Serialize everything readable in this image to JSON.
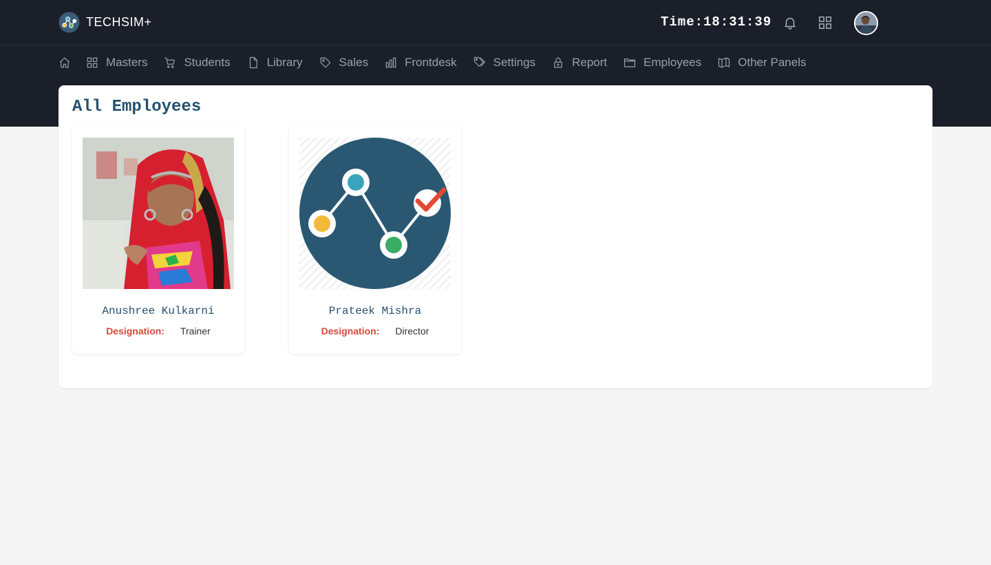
{
  "app": {
    "brand_name": "TECHSIM+",
    "clock_text": "Time:18:31:39"
  },
  "topbar": {
    "icons": [
      "bell-icon",
      "apps-grid-icon"
    ],
    "avatar": "user-avatar"
  },
  "nav": {
    "items": [
      {
        "label": "",
        "icon": "home-icon"
      },
      {
        "label": "Masters",
        "icon": "grid-icon"
      },
      {
        "label": "Students",
        "icon": "cart-icon"
      },
      {
        "label": "Library",
        "icon": "file-icon"
      },
      {
        "label": "Sales",
        "icon": "tag-icon"
      },
      {
        "label": "Frontdesk",
        "icon": "bar-chart-icon"
      },
      {
        "label": "Settings",
        "icon": "tags-icon"
      },
      {
        "label": "Report",
        "icon": "lock-icon"
      },
      {
        "label": "Employees",
        "icon": "folder-icon"
      },
      {
        "label": "Other Panels",
        "icon": "map-icon"
      }
    ]
  },
  "page": {
    "title": "All Employees"
  },
  "employees": [
    {
      "name": "Anushree Kulkarni",
      "designation_label": "Designation:",
      "designation": "Trainer",
      "photo": "employee-photo"
    },
    {
      "name": "Prateek Mishra",
      "designation_label": "Designation:",
      "designation": "Director",
      "photo": "analytics-logo-image"
    }
  ],
  "colors": {
    "header_bg": "#1b1f2a",
    "page_bg": "#f4f5f4",
    "title": "#25506f",
    "designation_label": "#d9483b",
    "nav_text": "#9aa0aa"
  }
}
